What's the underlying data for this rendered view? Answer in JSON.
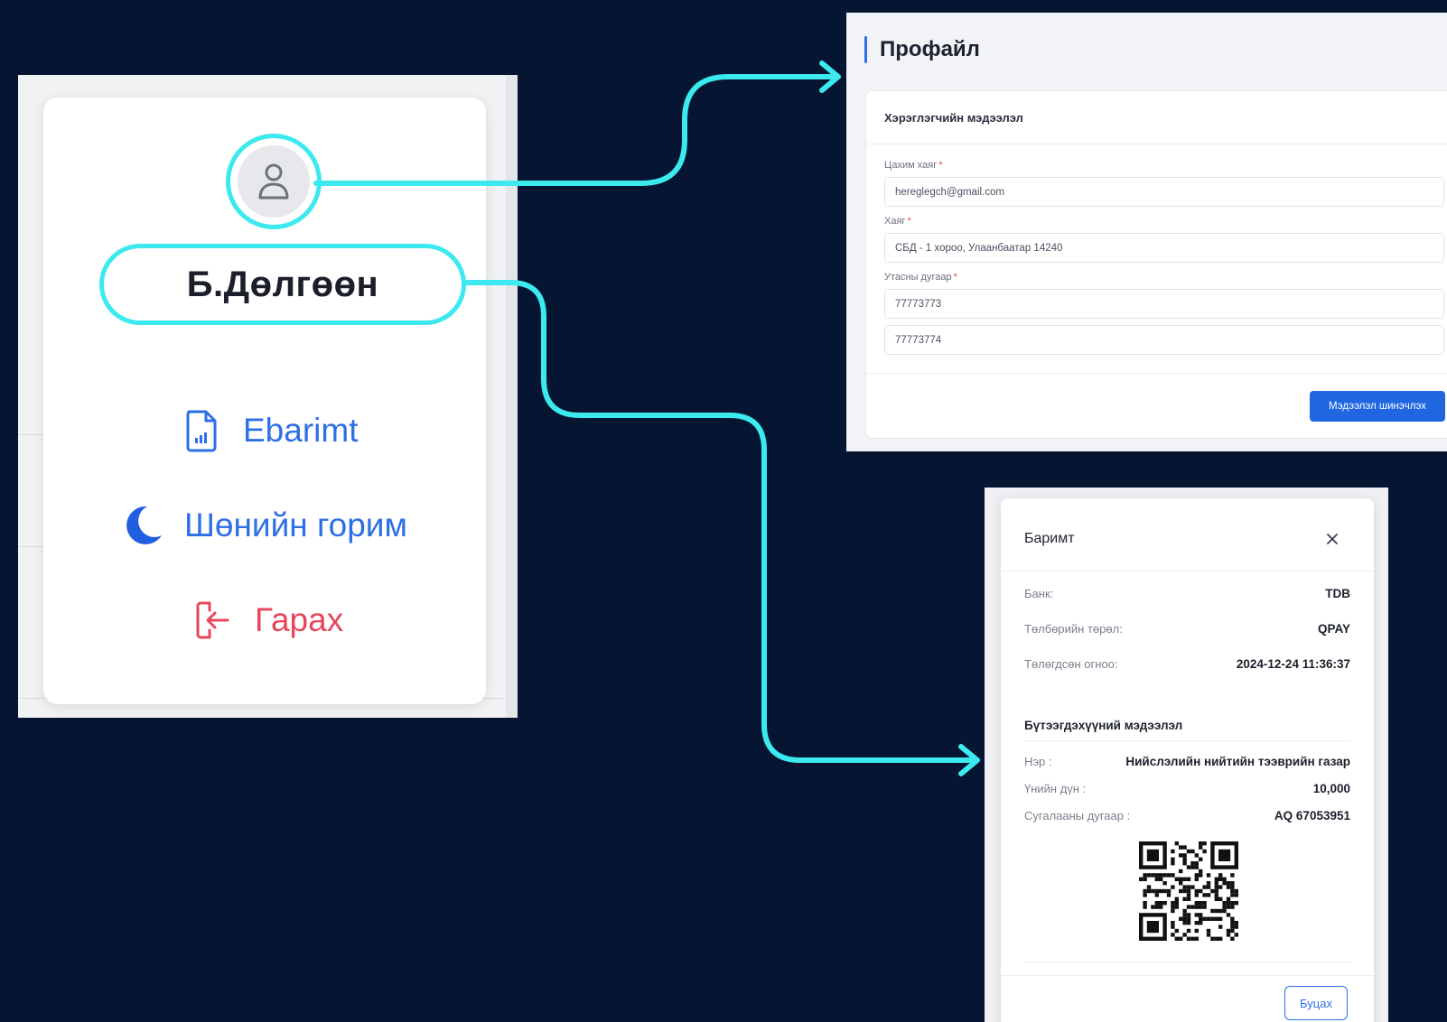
{
  "user_menu": {
    "user_name": "Б.Дөлгөөн",
    "items": [
      {
        "label": "Ebarimt",
        "icon": "receipt-document-icon",
        "color": "#2d6fe5"
      },
      {
        "label": "Шөнийн горим",
        "icon": "moon-icon",
        "color": "#2d6fe5"
      },
      {
        "label": "Гарах",
        "icon": "logout-icon",
        "color": "#e7475c"
      }
    ]
  },
  "profile": {
    "title": "Профайл",
    "section_title": "Хэрэглэгчийн мэдээлэл",
    "fields": [
      {
        "label": "Цахим хаяг",
        "required_mark": "*",
        "value": "hereglegch@gmail.com"
      },
      {
        "label": "Хаяг",
        "required_mark": "*",
        "value": "СБД - 1 хороо, Улаанбаатар 14240"
      },
      {
        "label": "Утасны дугаар",
        "required_mark": "*",
        "value": "77773773"
      }
    ],
    "extra_phone": "77773774",
    "update_button": "Мэдээлэл шинэчлэх"
  },
  "receipt": {
    "title": "Баримт",
    "close_symbol": "×",
    "payment_rows": [
      {
        "key": "Банк:",
        "value": "TDB"
      },
      {
        "key": "Төлбөрийн төрөл:",
        "value": "QPAY"
      },
      {
        "key": "Төлөгдсөн огноо:",
        "value": "2024-12-24 11:36:37"
      }
    ],
    "product_title": "Бүтээгдэхүүний мэдээлэл",
    "product_rows": [
      {
        "key": "Нэр :",
        "value": "Нийслэлийн нийтийн тээврийн газар"
      },
      {
        "key": "Үнийн дүн :",
        "value": "10,000"
      },
      {
        "key": "Сугалааны дугаар :",
        "value": "AQ 67053951"
      }
    ],
    "back_button": "Буцах"
  },
  "colors": {
    "background": "#061632",
    "connector": "#3ce9ef",
    "primary": "#2d6fe5",
    "danger": "#e7475c"
  }
}
